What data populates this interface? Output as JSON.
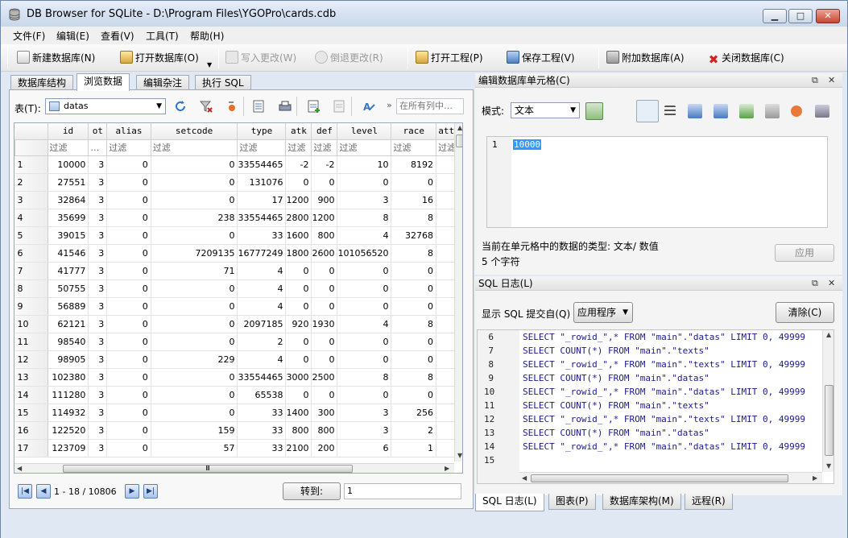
{
  "window": {
    "title": "DB Browser for SQLite - D:\\Program Files\\YGOPro\\cards.cdb",
    "btn_min": "▁",
    "btn_max": "□",
    "btn_close": "✕"
  },
  "menu": [
    "文件(F)",
    "编辑(E)",
    "查看(V)",
    "工具(T)",
    "帮助(H)"
  ],
  "toolbar": {
    "new_db": "新建数据库(N)",
    "open_db": "打开数据库(O)",
    "write_changes": "写入更改(W)",
    "revert_changes": "倒退更改(R)",
    "open_project": "打开工程(P)",
    "save_project": "保存工程(V)",
    "attach_db": "附加数据库(A)",
    "close_db": "关闭数据库(C)"
  },
  "left_tabs": [
    "数据库结构",
    "浏览数据",
    "编辑杂注",
    "执行 SQL"
  ],
  "browse": {
    "table_label": "表(T):",
    "table_name": "datas",
    "filter_all_placeholder": "在所有列中…",
    "chevron": "»",
    "columns": [
      "id",
      "ot",
      "alias",
      "setcode",
      "type",
      "atk",
      "def",
      "level",
      "race",
      "attr"
    ],
    "filter_text": "过滤",
    "filter_ellipsis": "…",
    "rows": [
      [
        "1",
        "10000",
        "3",
        "0",
        "0",
        "33554465",
        "-2",
        "-2",
        "10",
        "8192"
      ],
      [
        "2",
        "27551",
        "3",
        "0",
        "0",
        "131076",
        "0",
        "0",
        "0",
        "0"
      ],
      [
        "3",
        "32864",
        "3",
        "0",
        "0",
        "17",
        "1200",
        "900",
        "3",
        "16"
      ],
      [
        "4",
        "35699",
        "3",
        "0",
        "238",
        "33554465",
        "2800",
        "1200",
        "8",
        "8"
      ],
      [
        "5",
        "39015",
        "3",
        "0",
        "0",
        "33",
        "1600",
        "800",
        "4",
        "32768"
      ],
      [
        "6",
        "41546",
        "3",
        "0",
        "7209135",
        "16777249",
        "1800",
        "2600",
        "101056520",
        "8"
      ],
      [
        "7",
        "41777",
        "3",
        "0",
        "71",
        "4",
        "0",
        "0",
        "0",
        "0"
      ],
      [
        "8",
        "50755",
        "3",
        "0",
        "0",
        "4",
        "0",
        "0",
        "0",
        "0"
      ],
      [
        "9",
        "56889",
        "3",
        "0",
        "0",
        "4",
        "0",
        "0",
        "0",
        "0"
      ],
      [
        "10",
        "62121",
        "3",
        "0",
        "0",
        "2097185",
        "920",
        "1930",
        "4",
        "8"
      ],
      [
        "11",
        "98540",
        "3",
        "0",
        "0",
        "2",
        "0",
        "0",
        "0",
        "0"
      ],
      [
        "12",
        "98905",
        "3",
        "0",
        "229",
        "4",
        "0",
        "0",
        "0",
        "0"
      ],
      [
        "13",
        "102380",
        "3",
        "0",
        "0",
        "33554465",
        "3000",
        "2500",
        "8",
        "8"
      ],
      [
        "14",
        "111280",
        "3",
        "0",
        "0",
        "65538",
        "0",
        "0",
        "0",
        "0"
      ],
      [
        "15",
        "114932",
        "3",
        "0",
        "0",
        "33",
        "1400",
        "300",
        "3",
        "256"
      ],
      [
        "16",
        "122520",
        "3",
        "0",
        "159",
        "33",
        "800",
        "800",
        "3",
        "2"
      ],
      [
        "17",
        "123709",
        "3",
        "0",
        "57",
        "33",
        "2100",
        "200",
        "6",
        "1"
      ]
    ],
    "nav_status": "1 - 18 / 10806",
    "goto_label": "转到:",
    "goto_value": "1"
  },
  "edit_cell": {
    "title": "编辑数据库单元格(C)",
    "mode_label": "模式:",
    "mode_value": "文本",
    "line_no": "1",
    "value": "10000",
    "type_info": "当前在单元格中的数据的类型: 文本/ 数值",
    "char_count": "5 个字符",
    "apply": "应用"
  },
  "sql_log": {
    "title": "SQL 日志(L)",
    "submitted_by_label": "显示 SQL 提交自(Q)",
    "submitted_by_value": "应用程序",
    "clear": "清除(C)",
    "lines": [
      {
        "n": "6",
        "code": "SELECT \"_rowid_\",* FROM \"main\".\"datas\" LIMIT 0, 49999"
      },
      {
        "n": "7",
        "code": "SELECT COUNT(*) FROM \"main\".\"texts\""
      },
      {
        "n": "8",
        "code": "SELECT \"_rowid_\",* FROM \"main\".\"texts\" LIMIT 0, 49999"
      },
      {
        "n": "9",
        "code": "SELECT COUNT(*) FROM \"main\".\"datas\""
      },
      {
        "n": "10",
        "code": "SELECT \"_rowid_\",* FROM \"main\".\"datas\" LIMIT 0, 49999"
      },
      {
        "n": "11",
        "code": "SELECT COUNT(*) FROM \"main\".\"texts\""
      },
      {
        "n": "12",
        "code": "SELECT \"_rowid_\",* FROM \"main\".\"texts\" LIMIT 0, 49999"
      },
      {
        "n": "13",
        "code": "SELECT COUNT(*) FROM \"main\".\"datas\""
      },
      {
        "n": "14",
        "code": "SELECT \"_rowid_\",* FROM \"main\".\"datas\" LIMIT 0, 49999"
      },
      {
        "n": "15",
        "code": ""
      }
    ]
  },
  "bottom_tabs": [
    "SQL 日志(L)",
    "图表(P)",
    "数据库架构(M)",
    "远程(R)"
  ],
  "colors": {
    "accent": "#3399ff",
    "title_bar": "#c8d7ea",
    "close_button": "#c7462e"
  }
}
